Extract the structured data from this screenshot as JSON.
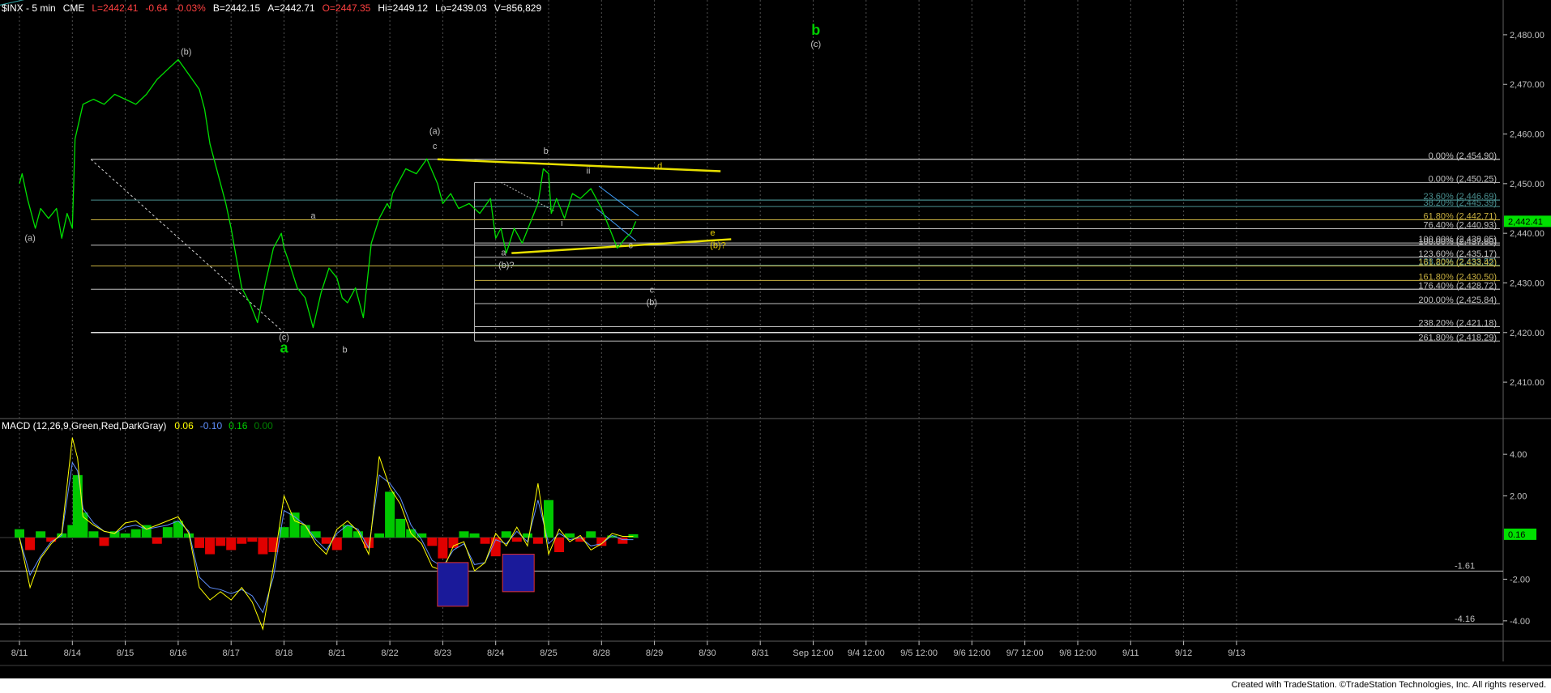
{
  "header": {
    "symbol": "$INX - 5 min",
    "exchange": "CME",
    "last": "L=2442.41",
    "change": "-0.64",
    "change_pct": "-0.03%",
    "bid": "B=2442.15",
    "ask": "A=2442.71",
    "open": "O=2447.35",
    "high": "Hi=2449.12",
    "low": "Lo=2439.03",
    "volume": "V=856,829"
  },
  "chart_data": [
    {
      "type": "line",
      "title": "$INX - 5 min",
      "ylim": [
        2403,
        2487
      ],
      "y_ticks": [
        "2,480.00",
        "2,470.00",
        "2,460.00",
        "2,450.00",
        "2,440.00",
        "2,430.00",
        "2,420.00",
        "2,410.00"
      ],
      "y_tick_values": [
        2480,
        2470,
        2460,
        2450,
        2440,
        2430,
        2420,
        2410
      ],
      "x_ticks": [
        "8/11",
        "8/14",
        "8/15",
        "8/16",
        "8/17",
        "8/18",
        "8/21",
        "8/22",
        "8/23",
        "8/24",
        "8/25",
        "8/28",
        "8/29",
        "8/30",
        "8/31",
        "Sep 12:00",
        "9/4 12:00",
        "9/5 12:00",
        "9/6 12:00",
        "9/7 12:00",
        "9/8 12:00",
        "9/11",
        "9/12",
        "9/13"
      ],
      "x_tick_pos": [
        0,
        1,
        2,
        3,
        4,
        5,
        6,
        7,
        8,
        9,
        10,
        11,
        12,
        13,
        14,
        15,
        16,
        17,
        18,
        19,
        20,
        21,
        22,
        23
      ],
      "last_price_label": "2,442.41",
      "last_price": 2442.41,
      "series": [
        {
          "color": "#00e000",
          "x": [
            0,
            0.05,
            0.15,
            0.3,
            0.4,
            0.55,
            0.7,
            0.8,
            0.9,
            1.0,
            1.05,
            1.2,
            1.4,
            1.6,
            1.8,
            2.0,
            2.2,
            2.4,
            2.6,
            2.8,
            3.0,
            3.2,
            3.4,
            3.5,
            3.6,
            3.75,
            3.9,
            4.0,
            4.1,
            4.2,
            4.35,
            4.5,
            4.65,
            4.8,
            4.95,
            5.0,
            5.1,
            5.25,
            5.4,
            5.55,
            5.7,
            5.85,
            6.0,
            6.1,
            6.2,
            6.35,
            6.5,
            6.65,
            6.8,
            6.95,
            7.0,
            7.05,
            7.15,
            7.3,
            7.5,
            7.7,
            7.9,
            8.0,
            8.15,
            8.3,
            8.5,
            8.7,
            8.9,
            9.0,
            9.1,
            9.2,
            9.35,
            9.5,
            9.65,
            9.8,
            9.9,
            10.0,
            10.05,
            10.15,
            10.3,
            10.45,
            10.6,
            10.8,
            11.0,
            11.15,
            11.3,
            11.45,
            11.55,
            11.65
          ],
          "values": [
            2450,
            2452,
            2447,
            2441,
            2445,
            2443,
            2445,
            2439,
            2444,
            2441,
            2459,
            2466,
            2467,
            2466,
            2468,
            2467,
            2466,
            2468,
            2471,
            2473,
            2475,
            2472,
            2469,
            2465,
            2458,
            2452,
            2446,
            2441,
            2435,
            2429,
            2426,
            2422,
            2430,
            2437,
            2440,
            2437,
            2434,
            2429,
            2427,
            2421,
            2428,
            2433,
            2431,
            2427,
            2426,
            2429,
            2423,
            2438,
            2443,
            2446,
            2445,
            2448,
            2450,
            2453,
            2452,
            2455,
            2450,
            2446,
            2448,
            2445,
            2446,
            2444,
            2447,
            2439,
            2441,
            2436,
            2441,
            2438,
            2442,
            2446,
            2453,
            2452,
            2444,
            2447,
            2443,
            2448,
            2447,
            2449,
            2445,
            2441,
            2437,
            2439,
            2440,
            2442.41
          ]
        }
      ],
      "fib_lines": [
        {
          "label": "0.00% (2,454.90)",
          "value": 2454.9,
          "color": "#c0c0c0"
        },
        {
          "label": "0.00% (2,450.25)",
          "value": 2450.25,
          "color": "#c0c0c0"
        },
        {
          "label": "23.60% (2,446.69)",
          "value": 2446.69,
          "color": "#4a9090"
        },
        {
          "label": "38.20% (2,445.39)",
          "value": 2445.39,
          "color": "#4a9090"
        },
        {
          "label": "61.80% (2,442.71)",
          "value": 2442.71,
          "color": "#c8b040"
        },
        {
          "label": "76.40% (2,440.93)",
          "value": 2440.93,
          "color": "#c0c0c0"
        },
        {
          "label": "100.00% (2,438.05)",
          "value": 2438.05,
          "color": "#c0c0c0"
        },
        {
          "label": "100.00% (2,437.60)",
          "value": 2437.6,
          "color": "#c0c0c0"
        },
        {
          "label": "123.60% (2,435.17)",
          "value": 2435.17,
          "color": "#c0c0c0"
        },
        {
          "label": "138.20% (2,433.55)",
          "value": 2433.55,
          "color": "#4a9090"
        },
        {
          "label": "161.80% (2,433.42)",
          "value": 2433.42,
          "color": "#c8b040"
        },
        {
          "label": "161.80% (2,430.50)",
          "value": 2430.5,
          "color": "#c8b040"
        },
        {
          "label": "176.40% (2,428.72)",
          "value": 2428.72,
          "color": "#c0c0c0"
        },
        {
          "label": "200.00% (2,425.84)",
          "value": 2425.84,
          "color": "#c0c0c0"
        },
        {
          "label": "238.20% (2,421.18)",
          "value": 2421.18,
          "color": "#c0c0c0"
        },
        {
          "label": "261.80% (2,418.29)",
          "value": 2418.29,
          "color": "#c0c0c0"
        }
      ],
      "annotations": [
        {
          "text": "(a)",
          "x": 0.2,
          "y": 2438.5,
          "color": "#c0c0c0",
          "size": 11
        },
        {
          "text": "(b)",
          "x": 3.15,
          "y": 2476,
          "color": "#c0c0c0",
          "size": 11
        },
        {
          "text": "(c)",
          "x": 5.0,
          "y": 2418.5,
          "color": "#c0c0c0",
          "size": 11
        },
        {
          "text": "a",
          "x": 5.0,
          "y": 2416,
          "color": "#00d000",
          "size": 18,
          "bold": true
        },
        {
          "text": "a",
          "x": 5.55,
          "y": 2443,
          "color": "#c0c0c0",
          "size": 11
        },
        {
          "text": "b",
          "x": 6.15,
          "y": 2416,
          "color": "#c0c0c0",
          "size": 11
        },
        {
          "text": "(a)",
          "x": 7.85,
          "y": 2460,
          "color": "#c0c0c0",
          "size": 11
        },
        {
          "text": "c",
          "x": 7.85,
          "y": 2457,
          "color": "#c0c0c0",
          "size": 11
        },
        {
          "text": "b",
          "x": 9.95,
          "y": 2456,
          "color": "#c0c0c0",
          "size": 11
        },
        {
          "text": "ii",
          "x": 10.75,
          "y": 2452,
          "color": "#c0c0c0",
          "size": 11
        },
        {
          "text": "i",
          "x": 10.25,
          "y": 2441.5,
          "color": "#c0c0c0",
          "size": 11
        },
        {
          "text": "d",
          "x": 12.1,
          "y": 2453,
          "color": "#e8d000",
          "size": 11
        },
        {
          "text": "a",
          "x": 9.15,
          "y": 2435.5,
          "color": "#c0c0c0",
          "size": 11
        },
        {
          "text": "(b)?",
          "x": 9.2,
          "y": 2433,
          "color": "#c0c0c0",
          "size": 11
        },
        {
          "text": "c",
          "x": 11.55,
          "y": 2437,
          "color": "#c0c0c0",
          "size": 11
        },
        {
          "text": "e",
          "x": 13.1,
          "y": 2439.5,
          "color": "#e8d000",
          "size": 11
        },
        {
          "text": "(b)?",
          "x": 13.2,
          "y": 2437,
          "color": "#e8d000",
          "size": 11
        },
        {
          "text": "c",
          "x": 11.95,
          "y": 2428,
          "color": "#c0c0c0",
          "size": 11
        },
        {
          "text": "(b)",
          "x": 11.95,
          "y": 2425.5,
          "color": "#c0c0c0",
          "size": 11
        },
        {
          "text": "b",
          "x": 15.05,
          "y": 2480,
          "color": "#00d000",
          "size": 18,
          "bold": true
        },
        {
          "text": "(c)",
          "x": 15.05,
          "y": 2477.5,
          "color": "#c0c0c0",
          "size": 11
        }
      ]
    },
    {
      "type": "line",
      "title": "MACD (12,26,9,Green,Red,DarkGray)",
      "legend_values": [
        "0.06",
        "-0.10",
        "0.16",
        "0.00"
      ],
      "legend_colors": [
        "#ffff00",
        "#6090ff",
        "#00d000",
        "#008000"
      ],
      "ylim": [
        -4.9,
        5.6
      ],
      "y_ticks": [
        "4.00",
        "2.00",
        "-2.00",
        "-4.00"
      ],
      "y_tick_values": [
        4,
        2,
        -2,
        -4
      ],
      "level_labels": [
        "-1.61",
        "-4.16"
      ],
      "level_values": [
        -1.61,
        -4.16
      ],
      "current_value_label": "0.16",
      "current_value": 0.16,
      "histogram_x": [
        0,
        0.2,
        0.4,
        0.6,
        0.8,
        1.0,
        1.1,
        1.2,
        1.4,
        1.6,
        1.8,
        2.0,
        2.2,
        2.4,
        2.6,
        2.8,
        3.0,
        3.2,
        3.4,
        3.6,
        3.8,
        4.0,
        4.2,
        4.4,
        4.6,
        4.8,
        5.0,
        5.2,
        5.4,
        5.6,
        5.8,
        6.0,
        6.2,
        6.4,
        6.6,
        6.8,
        7.0,
        7.2,
        7.4,
        7.6,
        7.8,
        8.0,
        8.2,
        8.4,
        8.6,
        8.8,
        9.0,
        9.2,
        9.4,
        9.6,
        9.8,
        10.0,
        10.2,
        10.4,
        10.6,
        10.8,
        11.0,
        11.2,
        11.4,
        11.6
      ],
      "histogram": [
        0.4,
        -0.6,
        0.3,
        -0.2,
        0.2,
        0.6,
        3.0,
        1.2,
        0.3,
        -0.4,
        0.3,
        0.2,
        0.4,
        0.6,
        -0.3,
        0.5,
        0.8,
        0.2,
        -0.5,
        -0.8,
        -0.4,
        -0.6,
        -0.3,
        -0.2,
        -0.8,
        -0.7,
        0.5,
        1.2,
        0.6,
        0.3,
        -0.3,
        -0.6,
        0.6,
        0.3,
        -0.5,
        0.2,
        2.2,
        0.9,
        0.4,
        0.2,
        -0.4,
        -1.0,
        -0.5,
        0.3,
        0.2,
        -0.3,
        -0.9,
        0.3,
        -0.2,
        0.2,
        -0.3,
        1.8,
        -0.7,
        0.2,
        -0.2,
        0.3,
        -0.4,
        0.1,
        -0.3,
        0.16
      ],
      "macd_line": [
        0,
        -2.4,
        -1.0,
        -0.3,
        0.2,
        4.8,
        3.8,
        1.0,
        0.6,
        0.3,
        0.2,
        0.7,
        0.8,
        0.4,
        0.6,
        0.8,
        1.0,
        0.2,
        -2.4,
        -3.0,
        -2.6,
        -3.0,
        -2.4,
        -3.1,
        -4.4,
        -1.4,
        2.0,
        0.8,
        0.6,
        -0.3,
        -0.8,
        0.4,
        0.8,
        0.3,
        -0.8,
        3.9,
        2.4,
        1.6,
        0.2,
        -0.3,
        -1.4,
        -1.6,
        -0.4,
        -0.2,
        -1.6,
        -1.2,
        0.2,
        -0.4,
        0.5,
        -0.4,
        2.6,
        -0.8,
        0.4,
        -0.2,
        0.1,
        -0.6,
        -0.3,
        0.2,
        0.06,
        0.06
      ],
      "signal_line": [
        0,
        -1.8,
        -0.9,
        -0.2,
        0.1,
        3.6,
        3.2,
        1.4,
        0.7,
        0.3,
        0.2,
        0.5,
        0.6,
        0.4,
        0.5,
        0.6,
        0.8,
        0.3,
        -1.9,
        -2.4,
        -2.5,
        -2.7,
        -2.5,
        -2.8,
        -3.6,
        -1.9,
        1.3,
        1.0,
        0.6,
        -0.1,
        -0.6,
        0.2,
        0.6,
        0.4,
        -0.5,
        3.0,
        2.6,
        1.9,
        0.6,
        -0.1,
        -1.1,
        -1.4,
        -0.6,
        -0.3,
        -1.3,
        -1.2,
        -0.1,
        -0.3,
        0.3,
        -0.2,
        1.8,
        -0.3,
        0.2,
        -0.1,
        0.0,
        -0.4,
        -0.3,
        0.1,
        -0.1,
        -0.1
      ]
    }
  ],
  "footer": {
    "credit": "Created with TradeStation. ©TradeStation Technologies, Inc. All rights reserved."
  },
  "colors": {
    "price": "#00e000",
    "wedge_yellow": "#e8e000",
    "grid": "#505050",
    "axis_text": "#c0c0c0",
    "last_price_box": "#00e000"
  }
}
